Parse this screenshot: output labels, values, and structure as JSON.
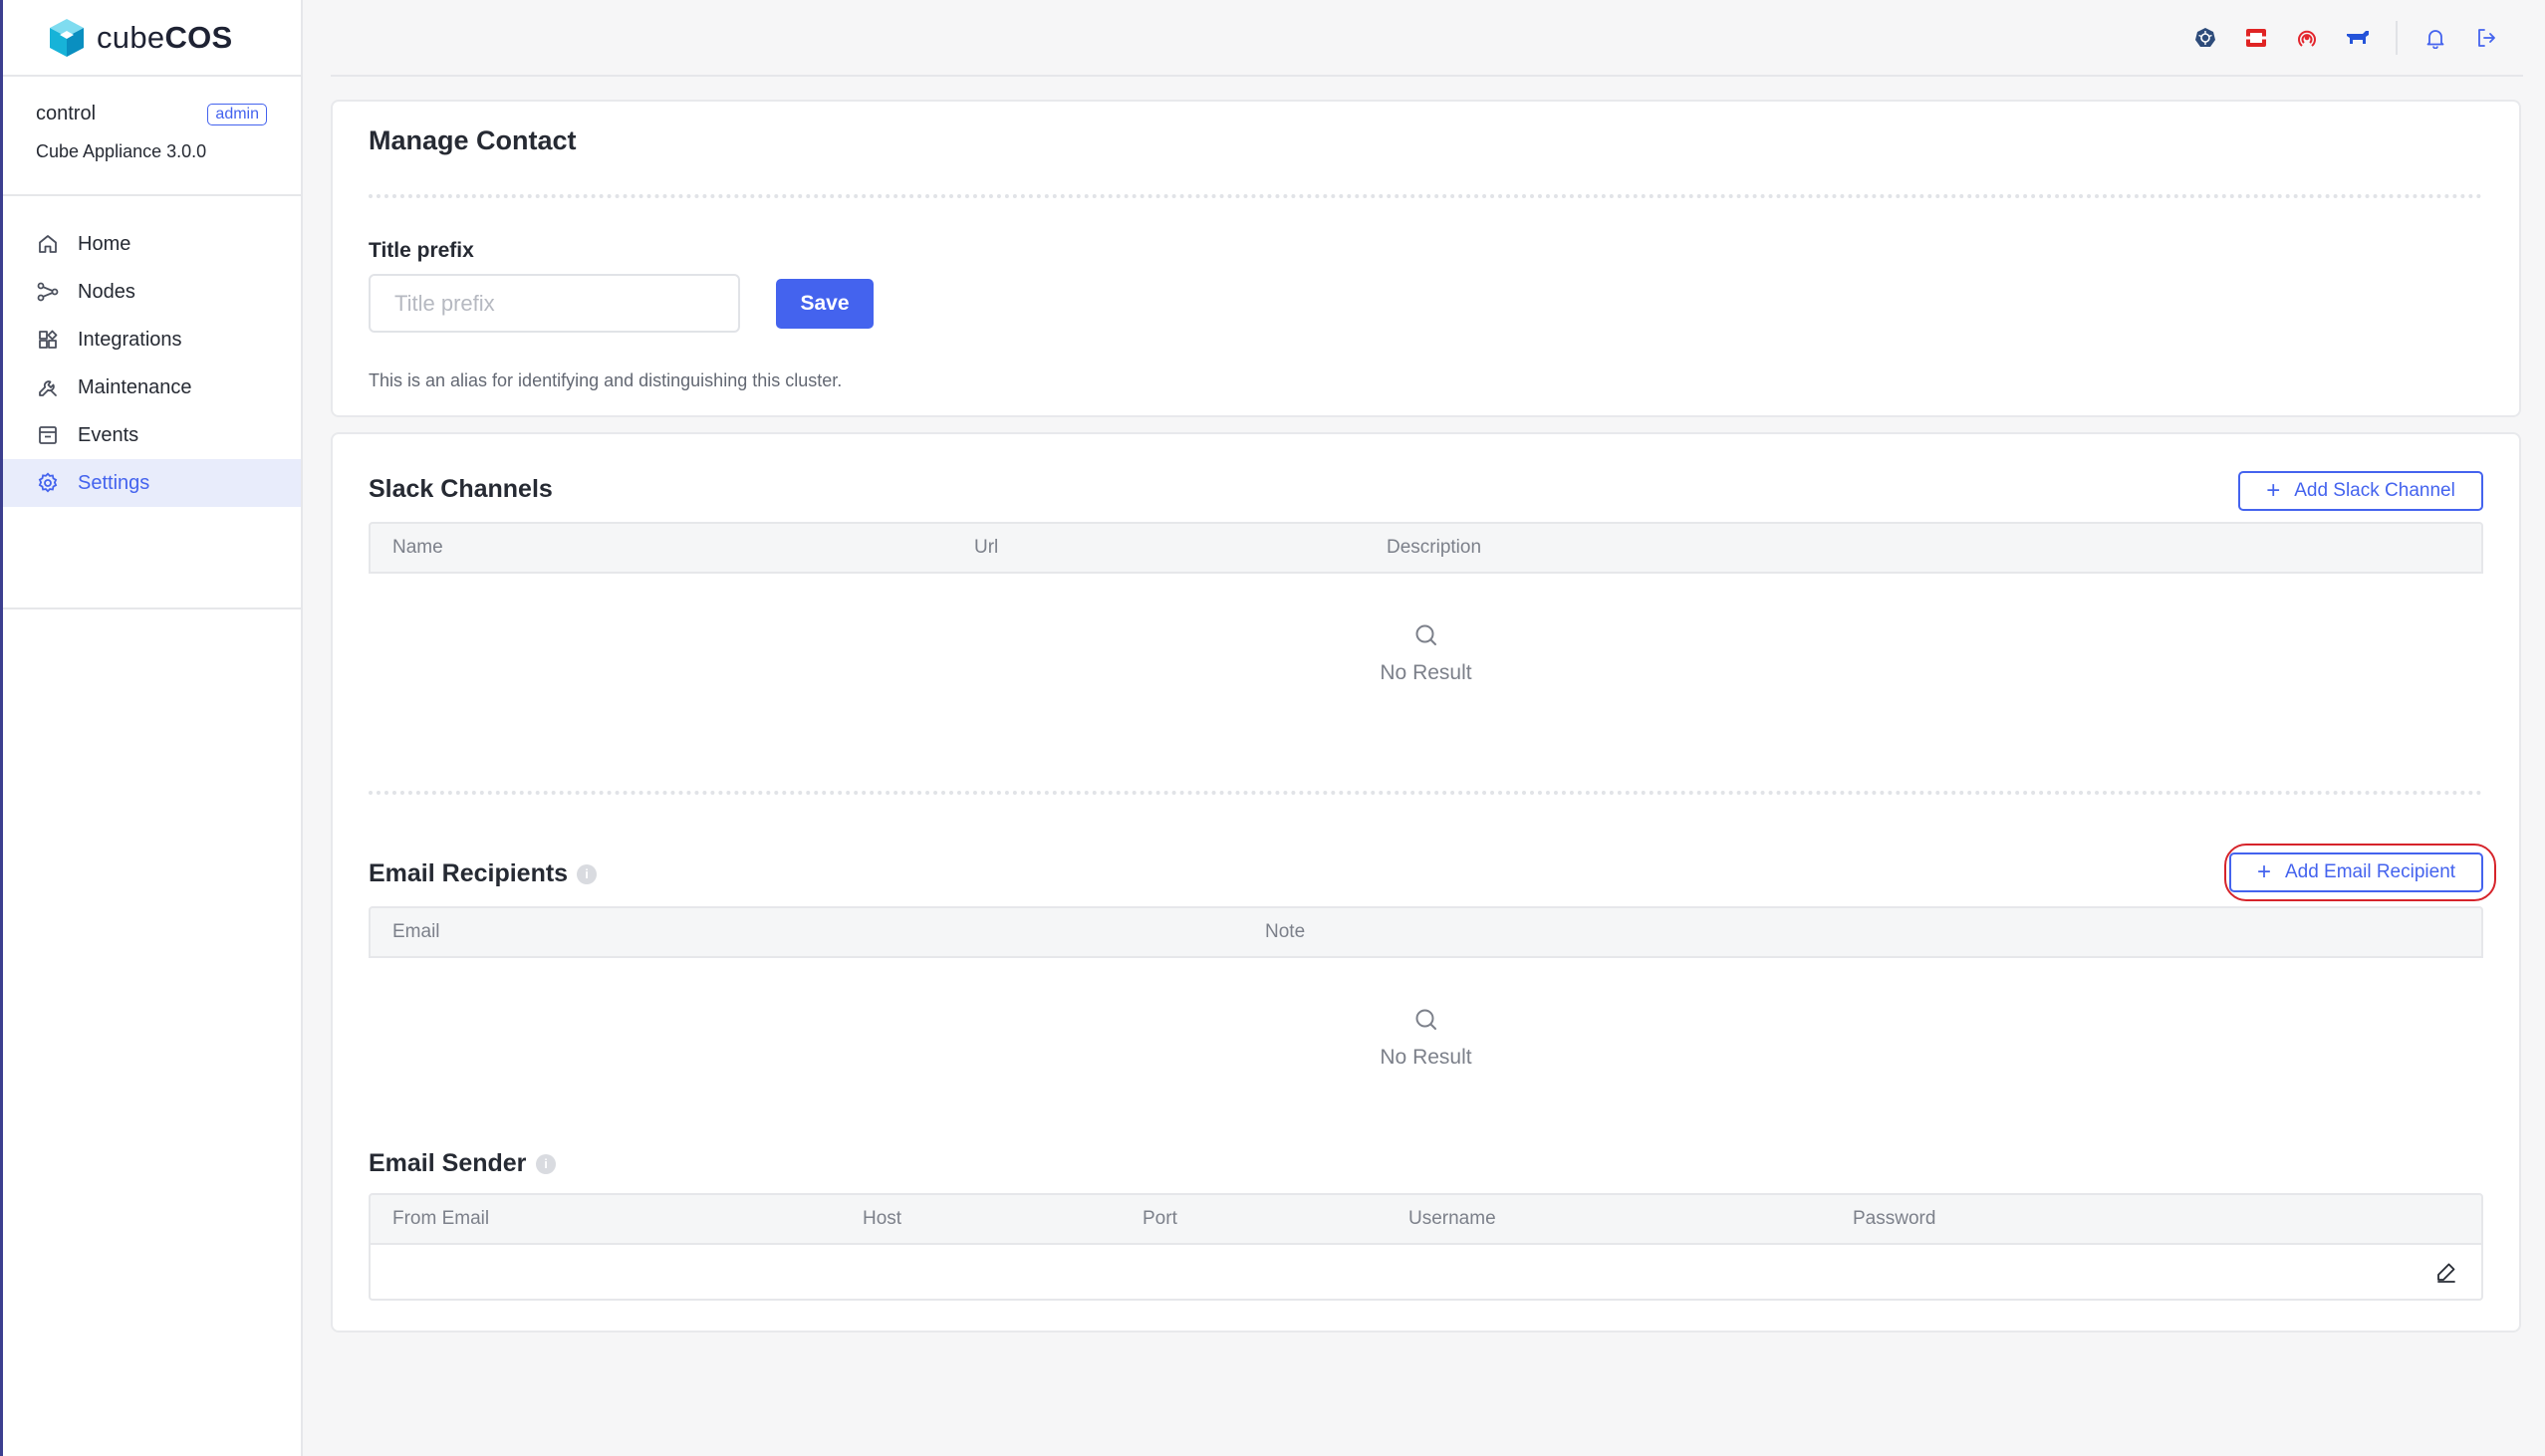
{
  "brand": {
    "light": "cube",
    "bold": "COS"
  },
  "account": {
    "user": "control",
    "role": "admin",
    "version": "Cube Appliance 3.0.0"
  },
  "nav": [
    {
      "label": "Home",
      "icon": "home-icon"
    },
    {
      "label": "Nodes",
      "icon": "nodes-icon"
    },
    {
      "label": "Integrations",
      "icon": "integrations-icon"
    },
    {
      "label": "Maintenance",
      "icon": "maintenance-icon"
    },
    {
      "label": "Events",
      "icon": "events-icon"
    },
    {
      "label": "Settings",
      "icon": "gear-icon",
      "active": true
    }
  ],
  "header_icons": [
    "kubernetes-icon",
    "openstack-icon",
    "ceph-icon",
    "rancher-icon",
    "bell-icon",
    "logout-icon"
  ],
  "colors": {
    "accent": "#4463ee",
    "highlight": "#d6242b",
    "active_bg": "#e8ecfb"
  },
  "contact": {
    "title": "Manage Contact",
    "title_prefix_label": "Title prefix",
    "title_prefix_value": "",
    "title_prefix_placeholder": "Title prefix",
    "save_label": "Save",
    "hint": "This is an alias for identifying and distinguishing this cluster."
  },
  "slack": {
    "title": "Slack Channels",
    "add_label": "Add Slack Channel",
    "columns": [
      "Name",
      "Url",
      "Description"
    ],
    "empty": "No Result"
  },
  "email_recipients": {
    "title": "Email Recipients",
    "add_label": "Add Email Recipient",
    "columns": [
      "Email",
      "Note"
    ],
    "empty": "No Result"
  },
  "email_sender": {
    "title": "Email Sender",
    "columns": [
      "From Email",
      "Host",
      "Port",
      "Username",
      "Password"
    ]
  }
}
